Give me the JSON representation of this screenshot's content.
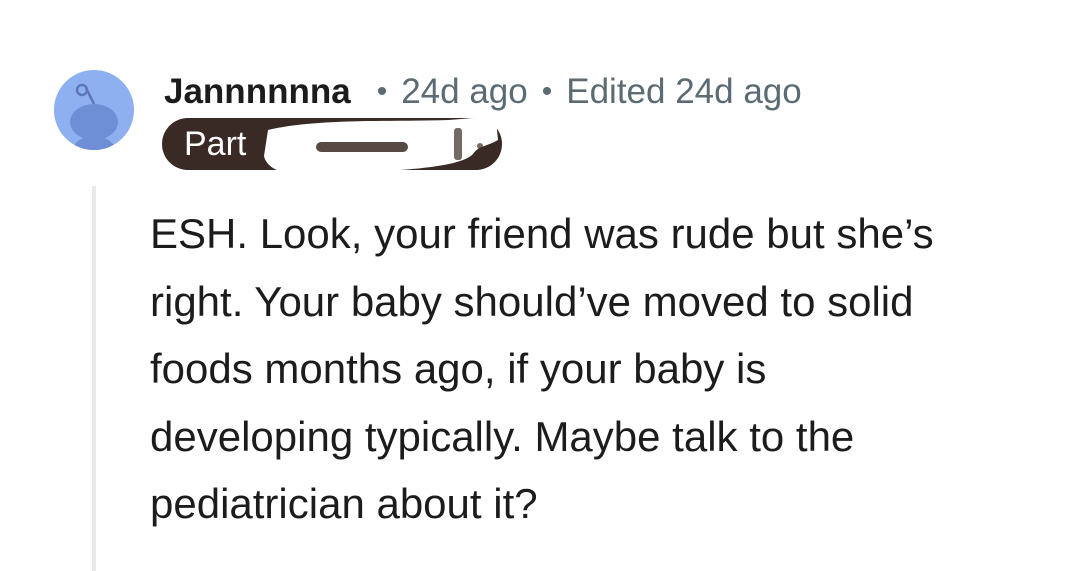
{
  "comment": {
    "author": "Jannnnnna",
    "separator": "•",
    "time": "24d ago",
    "edited": "Edited 24d ago",
    "flair": "Part",
    "body_lines": [
      "ESH. Look, your friend was rude but she’s",
      "right. Your baby should’ve moved to solid",
      "foods months ago, if your baby is",
      "developing typically. Maybe talk to the",
      "pediatrician about it?"
    ]
  },
  "colors": {
    "avatar_bg": "#8fb0f0",
    "flair_bg": "#3a2a25",
    "meta_text": "#5b6b73",
    "body_text": "#1c1c1c",
    "thread_line": "#e7e9eb"
  },
  "icons": {
    "avatar": "reddit-snoo-avatar-icon"
  }
}
